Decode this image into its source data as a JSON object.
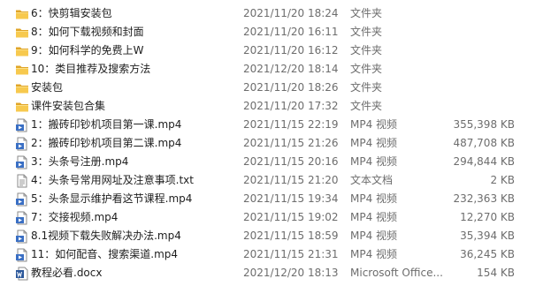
{
  "colors": {
    "folder_yellow": "#f7c94e",
    "folder_dark": "#e0a528",
    "video_icon_blue": "#3a6fc4",
    "word_icon_blue": "#2b579a",
    "secondary_text": "#6d6d6d"
  },
  "files": [
    {
      "name": "6：快剪辑安装包",
      "date": "2021/11/20 18:24",
      "type": "文件夹",
      "size": "",
      "icon": "folder-icon"
    },
    {
      "name": "8：如何下载视频和封面",
      "date": "2021/11/20 16:11",
      "type": "文件夹",
      "size": "",
      "icon": "folder-icon"
    },
    {
      "name": "9：如何科学的免费上W",
      "date": "2021/11/20 16:12",
      "type": "文件夹",
      "size": "",
      "icon": "folder-icon"
    },
    {
      "name": "10：类目推荐及搜索方法",
      "date": "2021/12/20 18:14",
      "type": "文件夹",
      "size": "",
      "icon": "folder-icon"
    },
    {
      "name": "安装包",
      "date": "2021/11/20 18:26",
      "type": "文件夹",
      "size": "",
      "icon": "folder-icon"
    },
    {
      "name": "课件安装包合集",
      "date": "2021/11/20 17:32",
      "type": "文件夹",
      "size": "",
      "icon": "folder-icon"
    },
    {
      "name": "1：搬砖印钞机项目第一课.mp4",
      "date": "2021/11/15 22:19",
      "type": "MP4 视频",
      "size": "355,398 KB",
      "icon": "video-file-icon"
    },
    {
      "name": "2：搬砖印钞机项目第二课.mp4",
      "date": "2021/11/15 21:26",
      "type": "MP4 视频",
      "size": "487,708 KB",
      "icon": "video-file-icon"
    },
    {
      "name": "3：头条号注册.mp4",
      "date": "2021/11/15 20:16",
      "type": "MP4 视频",
      "size": "294,844 KB",
      "icon": "video-file-icon"
    },
    {
      "name": "4：头条号常用网址及注意事项.txt",
      "date": "2021/11/15 21:20",
      "type": "文本文档",
      "size": "2 KB",
      "icon": "text-file-icon"
    },
    {
      "name": "5：头条显示维护看这节课程.mp4",
      "date": "2021/11/15 19:34",
      "type": "MP4 视频",
      "size": "232,363 KB",
      "icon": "video-file-icon"
    },
    {
      "name": "7：交接视频.mp4",
      "date": "2021/11/15 19:02",
      "type": "MP4 视频",
      "size": "12,270 KB",
      "icon": "video-file-icon"
    },
    {
      "name": "8.1视频下载失败解决办法.mp4",
      "date": "2021/11/15 18:59",
      "type": "MP4 视频",
      "size": "35,394 KB",
      "icon": "video-file-icon"
    },
    {
      "name": "11：如何配音、搜索渠道.mp4",
      "date": "2021/11/15 21:31",
      "type": "MP4 视频",
      "size": "36,245 KB",
      "icon": "video-file-icon"
    },
    {
      "name": "教程必看.docx",
      "date": "2021/12/20 18:13",
      "type": "Microsoft Office...",
      "size": "154 KB",
      "icon": "word-document-icon"
    }
  ]
}
